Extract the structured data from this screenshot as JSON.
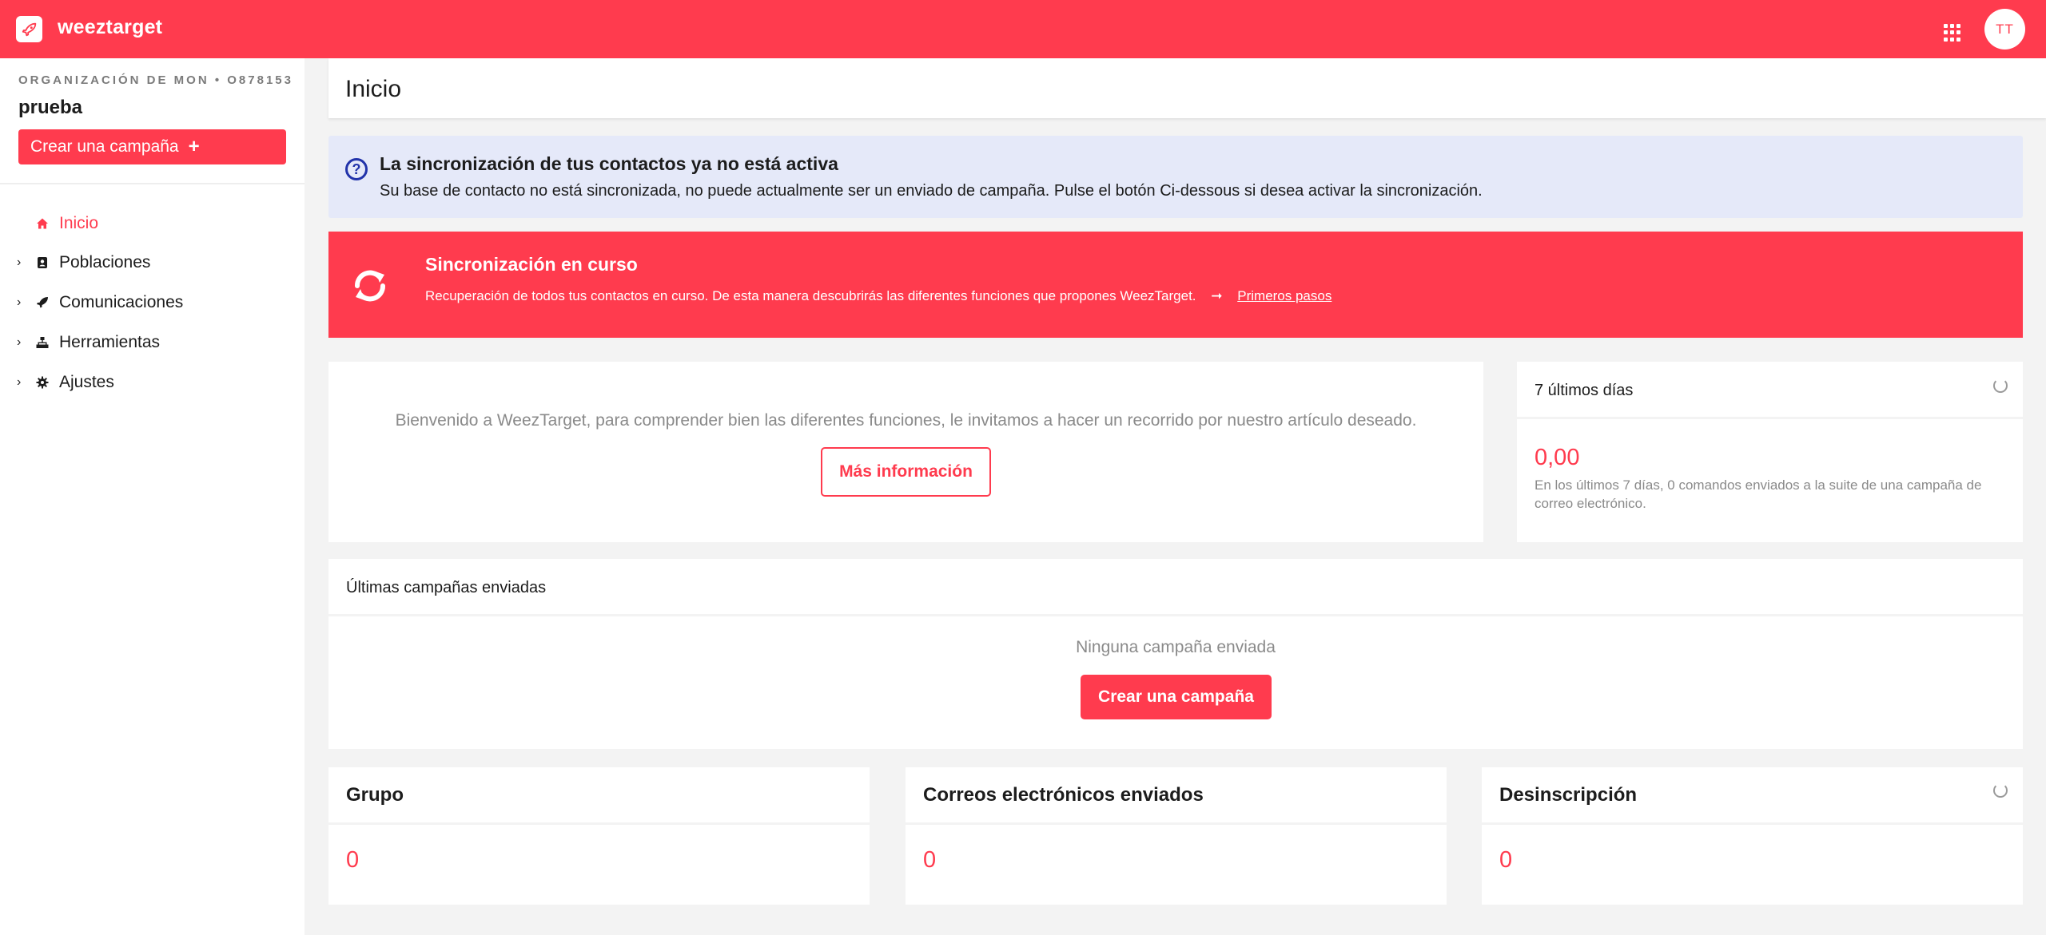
{
  "app": {
    "brand": "weeztarget",
    "avatar_initials": "TT",
    "accent_color": "#ff3b4e"
  },
  "sidebar": {
    "org_id": "ORGANIZACIÓN DE MON • O878153",
    "org_name": "prueba",
    "create_label": "Crear una campaña",
    "items": [
      {
        "label": "Inicio",
        "icon": "home-icon",
        "active": true
      },
      {
        "label": "Poblaciones",
        "icon": "contacts-icon",
        "expandable": true
      },
      {
        "label": "Comunicaciones",
        "icon": "rocket-icon",
        "expandable": true
      },
      {
        "label": "Herramientas",
        "icon": "sitemap-icon",
        "expandable": true
      },
      {
        "label": "Ajustes",
        "icon": "gear-icon",
        "expandable": true
      }
    ]
  },
  "header": {
    "title": "Inicio"
  },
  "info_banner": {
    "title": "La sincronización de tus contactos ya no está activa",
    "text": "Su base de contacto no está sincronizada, no puede actualmente ser un enviado de campaña. Pulse el botón Ci-dessous si desea activar la sincronización."
  },
  "sync_banner": {
    "title": "Sincronización en curso",
    "text": "Recuperación de todos tus contactos en curso. De esta manera descubrirás las diferentes funciones que propones WeezTarget.",
    "arrow": "➞",
    "link": "Primeros pasos"
  },
  "welcome": {
    "text": "Bienvenido a WeezTarget, para comprender bien las diferentes funciones, le invitamos a hacer un recorrido por nuestro artículo deseado.",
    "button": "Más información"
  },
  "stats": {
    "title": "7 últimos días",
    "value": "0,00",
    "desc": "En los últimos 7 días, 0 comandos enviados a la suite de una campaña de correo electrónico."
  },
  "campaigns": {
    "title": "Últimas campañas enviadas",
    "empty": "Ninguna campaña enviada",
    "button": "Crear una campaña"
  },
  "metrics": [
    {
      "title": "Grupo",
      "value": "0"
    },
    {
      "title": "Correos electrónicos enviados",
      "value": "0"
    },
    {
      "title": "Desinscripción",
      "value": "0"
    }
  ]
}
